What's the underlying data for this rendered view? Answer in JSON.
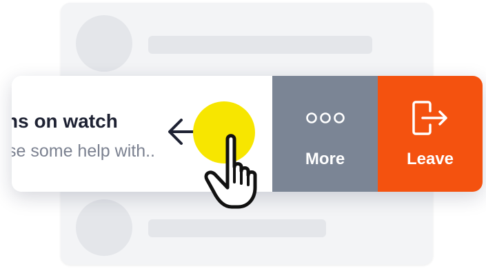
{
  "row": {
    "title": "ns on watch",
    "subtitle": "se some help with.."
  },
  "actions": {
    "more_label": "More",
    "leave_label": "Leave"
  },
  "icons": {
    "swipe_arrow": "arrow-left-icon",
    "more": "more-dots-icon",
    "leave": "exit-door-icon",
    "gesture": "hand-pointer-icon"
  },
  "colors": {
    "more_bg": "#7b8595",
    "leave_bg": "#f4520f",
    "touch_dot": "#f7e600",
    "title_text": "#1e2233",
    "subtitle_text": "#7b8190"
  }
}
